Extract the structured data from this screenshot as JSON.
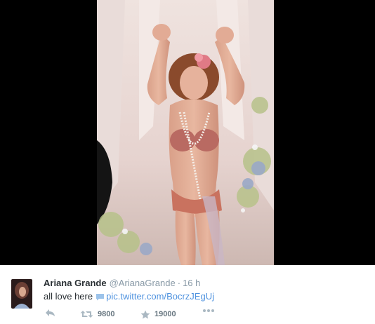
{
  "tweet": {
    "display_name": "Ariana Grande",
    "handle": "@ArianaGrande",
    "separator": "·",
    "timestamp": "16 h",
    "text": "all love here",
    "link": "pic.twitter.com/BocrzJEgUj",
    "media_icon": "image-icon",
    "actions": {
      "reply_icon": "reply-icon",
      "retweet_icon": "retweet-icon",
      "retweet_count": "9800",
      "favorite_icon": "star-icon",
      "favorite_count": "19000",
      "more_icon": "more-dots-icon"
    }
  },
  "colors": {
    "name": "#292f33",
    "meta": "#8899a6",
    "link": "#4e92df",
    "action_icon": "#aab8c2",
    "count": "#66757f",
    "media_background": "#000000"
  }
}
